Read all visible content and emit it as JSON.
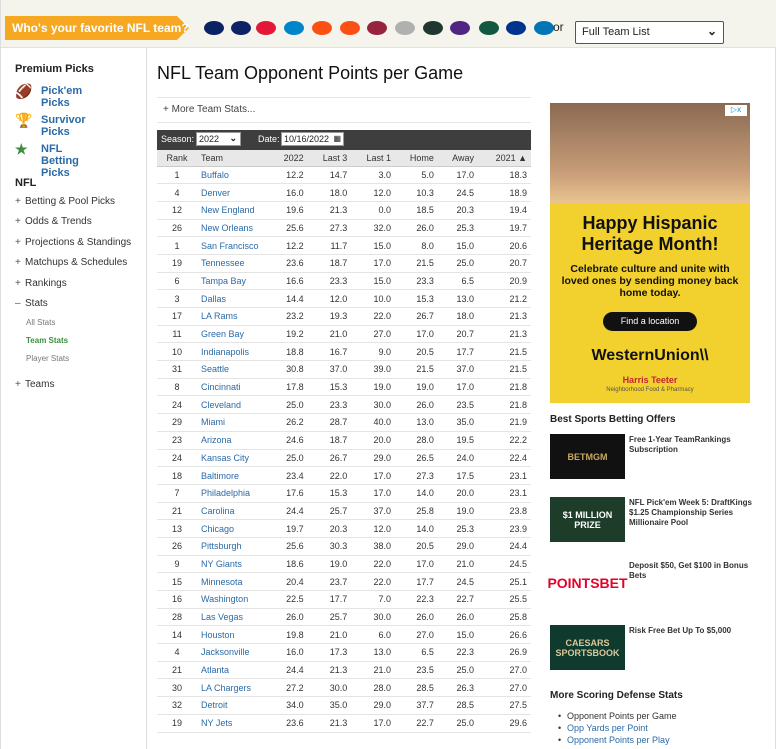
{
  "team_bar": {
    "question": "Who's your favorite NFL team?",
    "or_label": "or",
    "select_value": "Full Team List",
    "team_logos": [
      {
        "name": "seahawks-logo",
        "color": "#0b2265"
      },
      {
        "name": "patriots-logo",
        "color": "#0b2265"
      },
      {
        "name": "chiefs-logo",
        "color": "#e31837"
      },
      {
        "name": "panthers-logo",
        "color": "#0085ca"
      },
      {
        "name": "broncos-logo",
        "color": "#fb4f14"
      },
      {
        "name": "bengals-logo",
        "color": "#fb4f14"
      },
      {
        "name": "cardinals-logo",
        "color": "#97233f"
      },
      {
        "name": "steelers-logo",
        "color": "#b0b0b0"
      },
      {
        "name": "packers-logo",
        "color": "#203731"
      },
      {
        "name": "vikings-logo",
        "color": "#4f2683"
      },
      {
        "name": "jets-logo",
        "color": "#125740"
      },
      {
        "name": "bills-logo",
        "color": "#00338d"
      },
      {
        "name": "lions-logo",
        "color": "#0076b6"
      }
    ]
  },
  "sidebar": {
    "premium_heading": "Premium Picks",
    "picks": [
      {
        "label": "Pick'em Picks",
        "icon": "football-icon"
      },
      {
        "label": "Survivor Picks",
        "icon": "trophy-icon"
      },
      {
        "label": "NFL Betting Picks",
        "icon": "star-icon"
      }
    ],
    "nfl_heading": "NFL",
    "nav": [
      {
        "label": "Betting & Pool Picks",
        "sign": "+"
      },
      {
        "label": "Odds & Trends",
        "sign": "+"
      },
      {
        "label": "Projections & Standings",
        "sign": "+"
      },
      {
        "label": "Matchups & Schedules",
        "sign": "+"
      },
      {
        "label": "Rankings",
        "sign": "+"
      },
      {
        "label": "Stats",
        "sign": "–"
      }
    ],
    "stats_sub": [
      "All Stats",
      "Team Stats",
      "Player Stats"
    ],
    "teams": {
      "label": "Teams",
      "sign": "+"
    }
  },
  "main": {
    "title": "NFL Team Opponent Points per Game",
    "more_stats": "More Team Stats...",
    "season_label": "Season:",
    "season_value": "2022",
    "date_label": "Date:",
    "date_value": "10/16/2022",
    "columns": [
      "Rank",
      "Team",
      "2022",
      "Last 3",
      "Last 1",
      "Home",
      "Away",
      "2021"
    ],
    "rows": [
      [
        "1",
        "Buffalo",
        "12.2",
        "14.7",
        "3.0",
        "5.0",
        "17.0",
        "18.3"
      ],
      [
        "4",
        "Denver",
        "16.0",
        "18.0",
        "12.0",
        "10.3",
        "24.5",
        "18.9"
      ],
      [
        "12",
        "New England",
        "19.6",
        "21.3",
        "0.0",
        "18.5",
        "20.3",
        "19.4"
      ],
      [
        "26",
        "New Orleans",
        "25.6",
        "27.3",
        "32.0",
        "26.0",
        "25.3",
        "19.7"
      ],
      [
        "1",
        "San Francisco",
        "12.2",
        "11.7",
        "15.0",
        "8.0",
        "15.0",
        "20.6"
      ],
      [
        "19",
        "Tennessee",
        "23.6",
        "18.7",
        "17.0",
        "21.5",
        "25.0",
        "20.7"
      ],
      [
        "6",
        "Tampa Bay",
        "16.6",
        "23.3",
        "15.0",
        "23.3",
        "6.5",
        "20.9"
      ],
      [
        "3",
        "Dallas",
        "14.4",
        "12.0",
        "10.0",
        "15.3",
        "13.0",
        "21.2"
      ],
      [
        "17",
        "LA Rams",
        "23.2",
        "19.3",
        "22.0",
        "26.7",
        "18.0",
        "21.3"
      ],
      [
        "11",
        "Green Bay",
        "19.2",
        "21.0",
        "27.0",
        "17.0",
        "20.7",
        "21.3"
      ],
      [
        "10",
        "Indianapolis",
        "18.8",
        "16.7",
        "9.0",
        "20.5",
        "17.7",
        "21.5"
      ],
      [
        "31",
        "Seattle",
        "30.8",
        "37.0",
        "39.0",
        "21.5",
        "37.0",
        "21.5"
      ],
      [
        "8",
        "Cincinnati",
        "17.8",
        "15.3",
        "19.0",
        "19.0",
        "17.0",
        "21.8"
      ],
      [
        "24",
        "Cleveland",
        "25.0",
        "23.3",
        "30.0",
        "26.0",
        "23.5",
        "21.8"
      ],
      [
        "29",
        "Miami",
        "26.2",
        "28.7",
        "40.0",
        "13.0",
        "35.0",
        "21.9"
      ],
      [
        "23",
        "Arizona",
        "24.6",
        "18.7",
        "20.0",
        "28.0",
        "19.5",
        "22.2"
      ],
      [
        "24",
        "Kansas City",
        "25.0",
        "26.7",
        "29.0",
        "26.5",
        "24.0",
        "22.4"
      ],
      [
        "18",
        "Baltimore",
        "23.4",
        "22.0",
        "17.0",
        "27.3",
        "17.5",
        "23.1"
      ],
      [
        "7",
        "Philadelphia",
        "17.6",
        "15.3",
        "17.0",
        "14.0",
        "20.0",
        "23.1"
      ],
      [
        "21",
        "Carolina",
        "24.4",
        "25.7",
        "37.0",
        "25.8",
        "19.0",
        "23.8"
      ],
      [
        "13",
        "Chicago",
        "19.7",
        "20.3",
        "12.0",
        "14.0",
        "25.3",
        "23.9"
      ],
      [
        "26",
        "Pittsburgh",
        "25.6",
        "30.3",
        "38.0",
        "20.5",
        "29.0",
        "24.4"
      ],
      [
        "9",
        "NY Giants",
        "18.6",
        "19.0",
        "22.0",
        "17.0",
        "21.0",
        "24.5"
      ],
      [
        "15",
        "Minnesota",
        "20.4",
        "23.7",
        "22.0",
        "17.7",
        "24.5",
        "25.1"
      ],
      [
        "16",
        "Washington",
        "22.5",
        "17.7",
        "7.0",
        "22.3",
        "22.7",
        "25.5"
      ],
      [
        "28",
        "Las Vegas",
        "26.0",
        "25.7",
        "30.0",
        "26.0",
        "26.0",
        "25.8"
      ],
      [
        "14",
        "Houston",
        "19.8",
        "21.0",
        "6.0",
        "27.0",
        "15.0",
        "26.6"
      ],
      [
        "4",
        "Jacksonville",
        "16.0",
        "17.3",
        "13.0",
        "6.5",
        "22.3",
        "26.9"
      ],
      [
        "21",
        "Atlanta",
        "24.4",
        "21.3",
        "21.0",
        "23.5",
        "25.0",
        "27.0"
      ],
      [
        "30",
        "LA Chargers",
        "27.2",
        "30.0",
        "28.0",
        "28.5",
        "26.3",
        "27.0"
      ],
      [
        "32",
        "Detroit",
        "34.0",
        "35.0",
        "29.0",
        "37.7",
        "28.5",
        "27.5"
      ],
      [
        "19",
        "NY Jets",
        "23.6",
        "21.3",
        "17.0",
        "22.7",
        "25.0",
        "29.6"
      ]
    ]
  },
  "ad": {
    "adchoices": "▷x",
    "headline": "Happy Hispanic Heritage Month!",
    "body": "Celebrate culture and unite with loved ones by sending money back home today.",
    "button": "Find a location",
    "brand": "WesternUnion\\\\",
    "partner": "Harris Teeter",
    "partner_tag": "Neighborhood Food & Pharmacy"
  },
  "offers": {
    "title": "Best Sports Betting Offers",
    "items": [
      {
        "logo": "BETMGM",
        "text": "Free 1-Year TeamRankings Subscription",
        "bg": "#111111",
        "fg": "#c9a961"
      },
      {
        "logo": "$1 MILLION PRIZE",
        "text": "NFL Pick'em Week 5: DraftKings $1.25 Championship Series Millionaire Pool",
        "bg": "#1d3d2a",
        "fg": "#ffffff"
      },
      {
        "logo": "POINTSBET",
        "text": "Deposit $50, Get $100 in Bonus Bets",
        "bg": "#ffffff",
        "fg": "#e4002b"
      },
      {
        "logo": "CAESARS SPORTSBOOK",
        "text": "Risk Free Bet Up To $5,000",
        "bg": "#0f3a2e",
        "fg": "#d8c99b"
      }
    ]
  },
  "more_defense": {
    "title": "More Scoring Defense Stats",
    "items": [
      "Opponent Points per Game",
      "Opp Yards per Point",
      "Opponent Points per Play"
    ]
  }
}
